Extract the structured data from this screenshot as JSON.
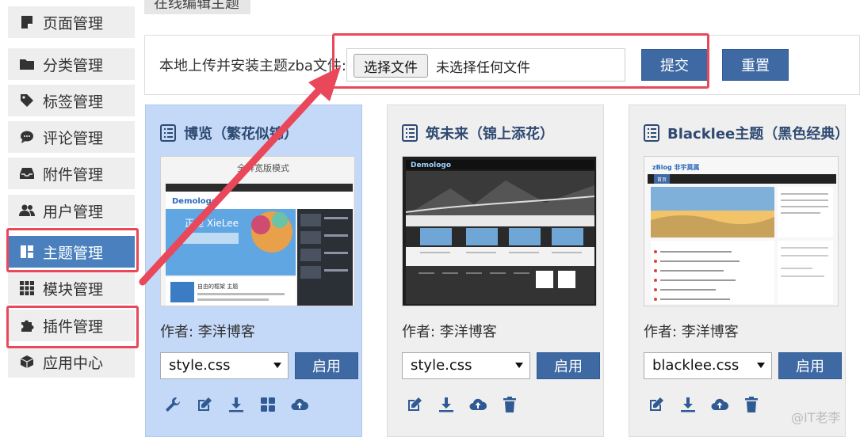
{
  "top_tab": {
    "label": "在线编辑主题"
  },
  "sidebar": {
    "items": [
      {
        "label": "页面管理",
        "icon": "page-icon"
      },
      {
        "label": "分类管理",
        "icon": "folder-icon"
      },
      {
        "label": "标签管理",
        "icon": "tag-icon"
      },
      {
        "label": "评论管理",
        "icon": "comment-icon"
      },
      {
        "label": "附件管理",
        "icon": "inbox-icon"
      },
      {
        "label": "用户管理",
        "icon": "users-icon"
      },
      {
        "label": "主题管理",
        "icon": "theme-icon",
        "active": true
      },
      {
        "label": "模块管理",
        "icon": "grid-icon"
      },
      {
        "label": "插件管理",
        "icon": "puzzle-icon"
      },
      {
        "label": "应用中心",
        "icon": "box-icon"
      }
    ]
  },
  "upload": {
    "label": "本地上传并安装主题zba文件:",
    "file_button": "选择文件",
    "file_status": "未选择任何文件",
    "submit_label": "提交",
    "reset_label": "重置"
  },
  "themes": [
    {
      "title": "博览（繁花似锦）",
      "author": "作者: 李洋博客",
      "stylesheet": "style.css",
      "enable_label": "启用",
      "selected": true,
      "thumb": {
        "banner": "全屏宽版模式",
        "logo": "Demologo",
        "slogan": "正能 XieLee",
        "feature": "自由的框架 主题"
      },
      "tools": [
        "wrench-icon",
        "edit-icon",
        "download-icon",
        "modules-icon",
        "cloud-upload-icon"
      ]
    },
    {
      "title": "筑未来（锦上添花）",
      "author": "作者: 李洋博客",
      "stylesheet": "style.css",
      "enable_label": "启用",
      "selected": false,
      "thumb": {
        "logo": "Demologo"
      },
      "tools": [
        "edit-icon",
        "download-icon",
        "cloud-upload-icon",
        "trash-icon"
      ]
    },
    {
      "title": "Blacklee主题（黑色经典）",
      "author": "作者: 李洋博客",
      "stylesheet": "blacklee.css",
      "enable_label": "启用",
      "selected": false,
      "thumb": {
        "logo": "zBlog 非宇莫属",
        "tab": "首页"
      },
      "tools": [
        "edit-icon",
        "download-icon",
        "cloud-upload-icon",
        "trash-icon"
      ]
    }
  ],
  "watermark": "@IT老李",
  "colors": {
    "accent": "#4a80bd",
    "button": "#3f69a3",
    "highlight": "#e8485a",
    "selected_card": "#c4d8f7"
  }
}
